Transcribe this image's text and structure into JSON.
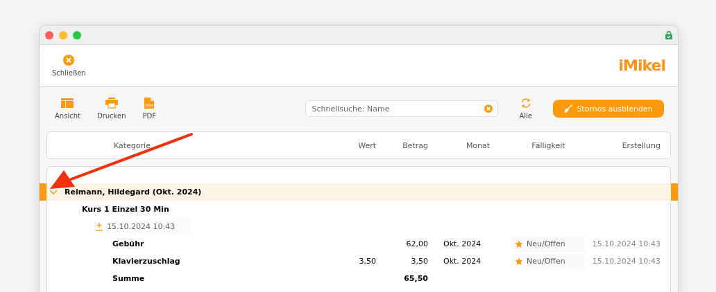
{
  "header": {
    "close_button": {
      "label": "Schließen"
    },
    "logo": {
      "text": "iMikel"
    }
  },
  "toolbar": {
    "items": [
      {
        "kind": "layout",
        "label": "Ansicht"
      },
      {
        "kind": "print",
        "label": "Drucken"
      },
      {
        "kind": "pdf",
        "label": "PDF"
      }
    ],
    "search": {
      "placeholder": "Schnellsuche: Name"
    },
    "refresh": {
      "label": "Alle"
    },
    "action_button": {
      "label": "Stornos ausblenden"
    }
  },
  "table": {
    "columns": [
      "Kategorie",
      "Wert",
      "Betrag",
      "Monat",
      "Fälligkeit",
      "Erstellung"
    ],
    "groups": [
      {
        "title": "Reimann, Hildegard (Okt. 2024)",
        "expanded": true,
        "selected": true,
        "children": [
          {
            "title": "Kurs 1 Einzel 30 Min",
            "children": [
              {
                "date": "15.10.2024 10:43",
                "rows": [
                  {
                    "kind": "item",
                    "category": "Gebühr",
                    "wert": "",
                    "betrag": "62,00",
                    "monat": "Okt. 2024",
                    "status": "Neu/Offen",
                    "erstellung": "15.10.2024 10:43"
                  },
                  {
                    "kind": "item",
                    "category": "Klavierzuschlag",
                    "wert": "3,50",
                    "betrag": "3,50",
                    "monat": "Okt. 2024",
                    "status": "Neu/Offen",
                    "erstellung": "15.10.2024 10:43"
                  },
                  {
                    "kind": "total",
                    "category": "Summe",
                    "betrag": "65,50"
                  }
                ]
              }
            ]
          }
        ]
      }
    ]
  }
}
